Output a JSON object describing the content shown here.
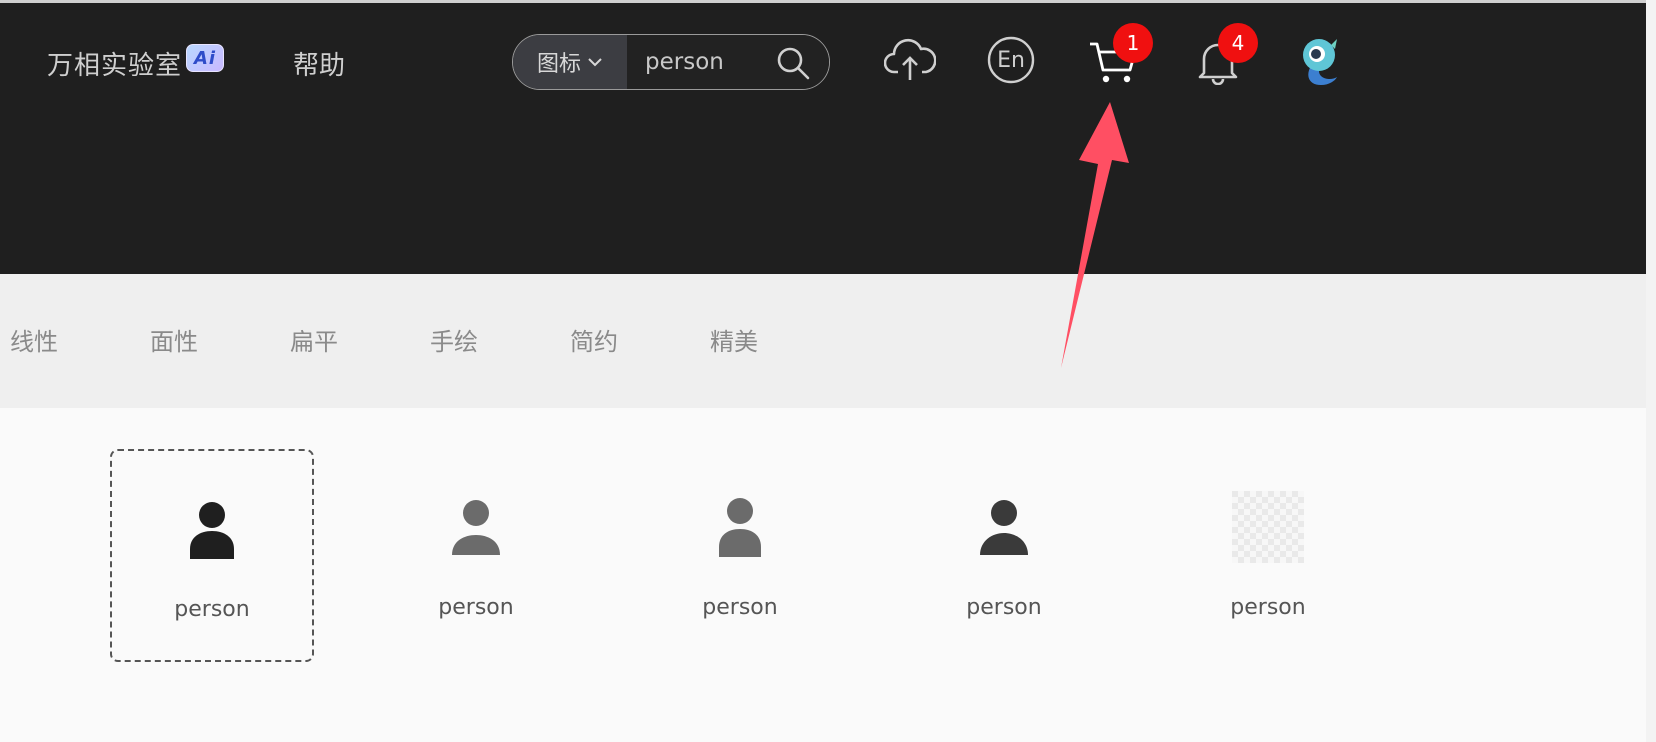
{
  "header": {
    "brand": "万相实验室",
    "brand_badge": "Ai",
    "help": "帮助",
    "search": {
      "type_label": "图标",
      "query": "person"
    },
    "upload_icon": "cloud-upload-icon",
    "language_label": "En",
    "cart_count": "1",
    "notification_count": "4",
    "avatar_icon": "mascot-avatar-icon"
  },
  "style_tabs": [
    "线性",
    "面性",
    "扁平",
    "手绘",
    "简约",
    "精美"
  ],
  "results": [
    {
      "label": "person",
      "icon": "person-icon",
      "color": "#1f1f1f",
      "selected": true
    },
    {
      "label": "person",
      "icon": "person-icon",
      "color": "#6b6b6b",
      "selected": false
    },
    {
      "label": "person",
      "icon": "person-icon",
      "color": "#6b6b6b",
      "selected": false
    },
    {
      "label": "person",
      "icon": "person-icon",
      "color": "#3a3a3a",
      "selected": false
    },
    {
      "label": "person",
      "icon": "transparent-placeholder-icon",
      "color": "#e6e6e6",
      "selected": false
    }
  ],
  "colors": {
    "header_bg": "#1f1f1f",
    "badge_red": "#f01010",
    "annotation_arrow": "#ff4f63"
  }
}
